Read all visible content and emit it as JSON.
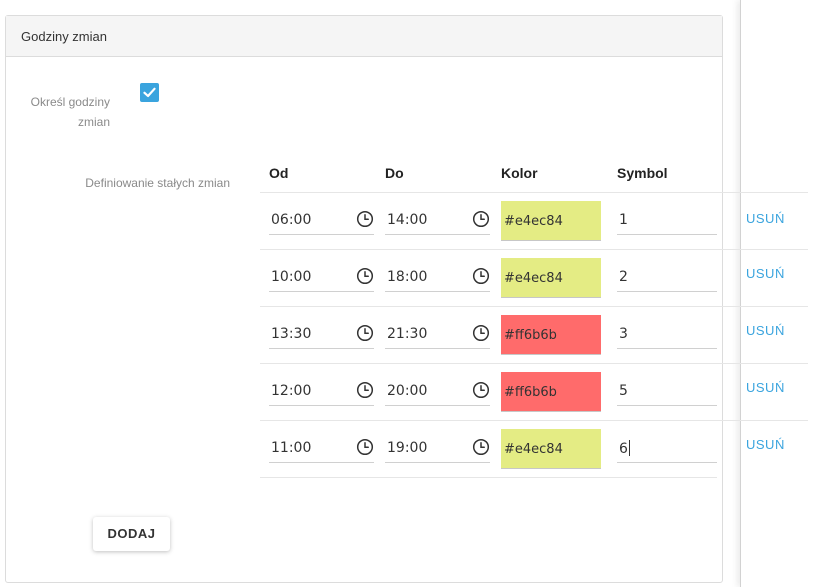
{
  "panel": {
    "title": "Godziny zmian"
  },
  "settings": {
    "define_hours_label": "Określ godziny zmian",
    "define_hours_checked": true,
    "fixed_shifts_label": "Definiowanie stałych zmian"
  },
  "table": {
    "headers": {
      "from": "Od",
      "to": "Do",
      "color": "Kolor",
      "symbol": "Symbol"
    },
    "rows": [
      {
        "from": "06:00",
        "to": "14:00",
        "color": "#e4ec84",
        "symbol": "1",
        "remove_label": "USUŃ"
      },
      {
        "from": "10:00",
        "to": "18:00",
        "color": "#e4ec84",
        "symbol": "2",
        "remove_label": "USUŃ"
      },
      {
        "from": "13:30",
        "to": "21:30",
        "color": "#ff6b6b",
        "symbol": "3",
        "remove_label": "USUŃ"
      },
      {
        "from": "12:00",
        "to": "20:00",
        "color": "#ff6b6b",
        "symbol": "5",
        "remove_label": "USUŃ"
      },
      {
        "from": "11:00",
        "to": "19:00",
        "color": "#e4ec84",
        "symbol": "6",
        "remove_label": "USUŃ"
      }
    ]
  },
  "actions": {
    "add_label": "DODAJ"
  },
  "icons": {
    "checkbox": "checkmark-icon",
    "time": "clock-icon"
  },
  "colors": {
    "accent": "#3aa4de"
  }
}
